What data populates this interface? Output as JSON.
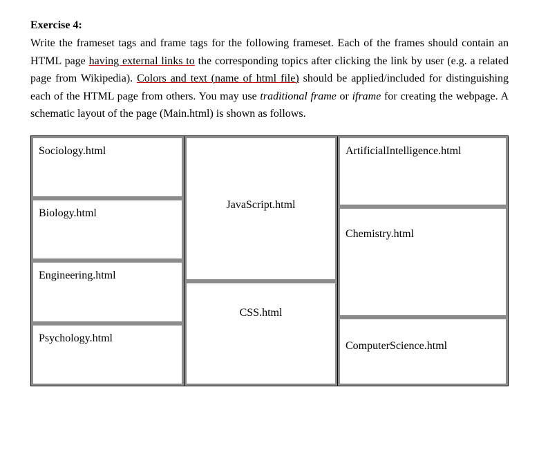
{
  "heading": "Exercise 4:",
  "para_parts": {
    "p1": "Write the frameset tags and frame tags for the following frameset. Each of the frames should contain an HTML page ",
    "u1": "having external links to",
    "p2": " the corresponding topics after clicking the link by user (e.g. a related page from Wikipedia). ",
    "u2": "Colors and text (name of html file)",
    "p3": " should be applied/included for distinguishing each of the HTML page from others. You may use ",
    "it1": "traditional frame",
    "p4": " or ",
    "it2": "iframe",
    "p5": " for creating the webpage. A schematic layout of the page (Main.html) is shown as follows."
  },
  "frames": {
    "col1": {
      "r1": "Sociology.html",
      "r2": "Biology.html",
      "r3": "Engineering.html",
      "r4": "Psychology.html"
    },
    "col2": {
      "r1": "JavaScript.html",
      "r2": "CSS.html"
    },
    "col3": {
      "r1": "ArtificialIntelligence.html",
      "r2": "Chemistry.html",
      "r3": "ComputerScience.html"
    }
  }
}
